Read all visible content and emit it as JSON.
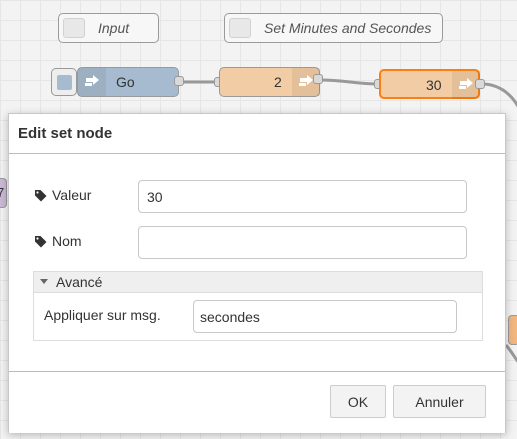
{
  "canvas": {
    "comments": [
      {
        "label": "Input"
      },
      {
        "label": "Set Minutes and Secondes"
      }
    ],
    "nodes": {
      "inject": {
        "label": "Go",
        "color": "#a6bbcf"
      },
      "set_two": {
        "label": "2",
        "color": "#f2cca4"
      },
      "set_thirty": {
        "label": "30",
        "color": "#f2cca4",
        "selected_border": "#ff7f0e"
      }
    },
    "left_stub_text": "7"
  },
  "dialog": {
    "title": "Edit set node",
    "fields": {
      "valeur": {
        "label": "Valeur",
        "value": "30"
      },
      "nom": {
        "label": "Nom",
        "value": ""
      }
    },
    "advanced": {
      "header": "Avancé",
      "apply_label": "Appliquer sur msg.",
      "apply_value": "secondes"
    },
    "buttons": {
      "ok": "OK",
      "cancel": "Annuler"
    }
  }
}
